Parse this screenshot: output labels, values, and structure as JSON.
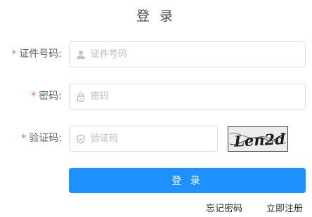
{
  "title": "登 录",
  "fields": {
    "id_number": {
      "label": "证件号码:",
      "placeholder": "证件号码",
      "value": "",
      "icon": "user-icon"
    },
    "password": {
      "label": "密码:",
      "placeholder": "密码",
      "value": "",
      "icon": "lock-icon"
    },
    "captcha": {
      "label": "验证码:",
      "placeholder": "验证码",
      "value": "",
      "icon": "shield-icon",
      "image_text": "Len2d"
    }
  },
  "required_mark": "*",
  "login_button": "登 录",
  "links": {
    "forgot_password": "忘记密码",
    "register": "立即注册"
  },
  "colors": {
    "primary": "#1f90ff",
    "required": "#f56c6c",
    "border": "#dcdfe6",
    "placeholder": "#b9bcc3"
  }
}
